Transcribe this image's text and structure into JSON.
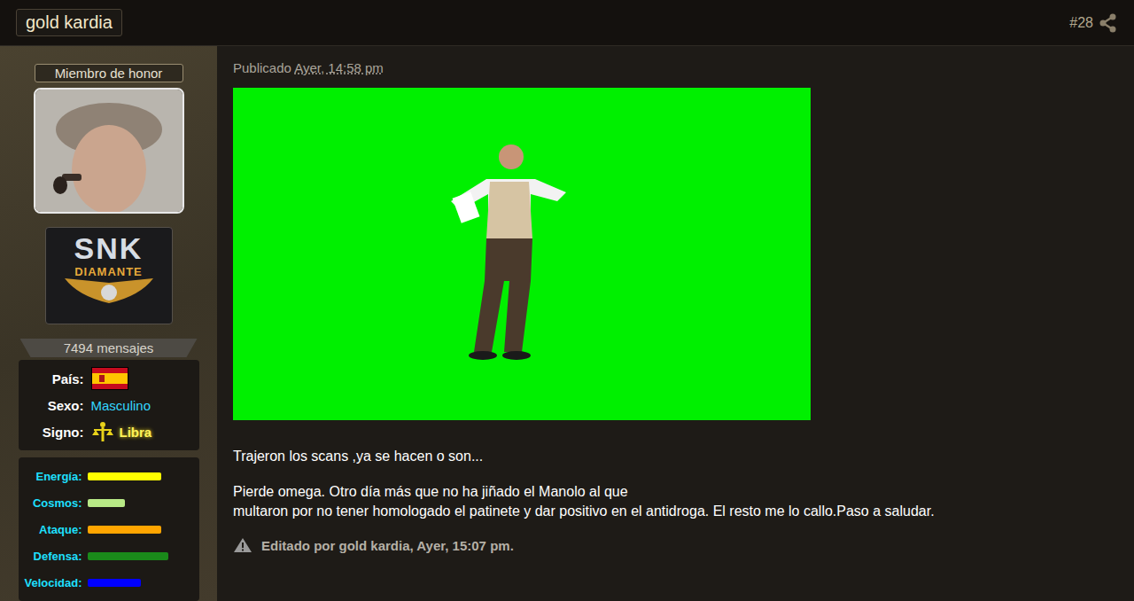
{
  "header": {
    "username": "gold kardia",
    "post_number": "#28"
  },
  "profile": {
    "rank": "Miembro de honor",
    "badge": {
      "title": "SNK",
      "subtitle": "DIAMANTE"
    },
    "message_count": "7494 mensajes",
    "fields": [
      {
        "label": "País:",
        "kind": "flag",
        "value": ""
      },
      {
        "label": "Sexo:",
        "kind": "text",
        "value": "Masculino"
      },
      {
        "label": "Signo:",
        "kind": "sign",
        "value": "Libra"
      }
    ],
    "stats": [
      {
        "label": "Energía:",
        "level": 0.92,
        "color": "#ffff00"
      },
      {
        "label": "Cosmos:",
        "level": 0.47,
        "color": "#b8e986"
      },
      {
        "label": "Ataque:",
        "level": 0.92,
        "color": "#ffa500"
      },
      {
        "label": "Defensa:",
        "level": 1.0,
        "color": "#1a8a1a"
      },
      {
        "label": "Velocidad:",
        "level": 0.66,
        "color": "#0000ff"
      }
    ]
  },
  "post": {
    "published_label": "Publicado",
    "published_time": "Ayer, 14:58 pm",
    "paragraphs": [
      [
        "Trajeron los scans ,ya se hacen o son..."
      ],
      [
        "Pierde omega. Otro día más que no ha jiñado el Manolo al que",
        "multaron por no tener homologado el patinete y dar positivo en el antidroga. El resto me lo callo.Paso a saludar."
      ]
    ],
    "edited": "Editado por gold kardia, Ayer, 15:07 pm."
  }
}
